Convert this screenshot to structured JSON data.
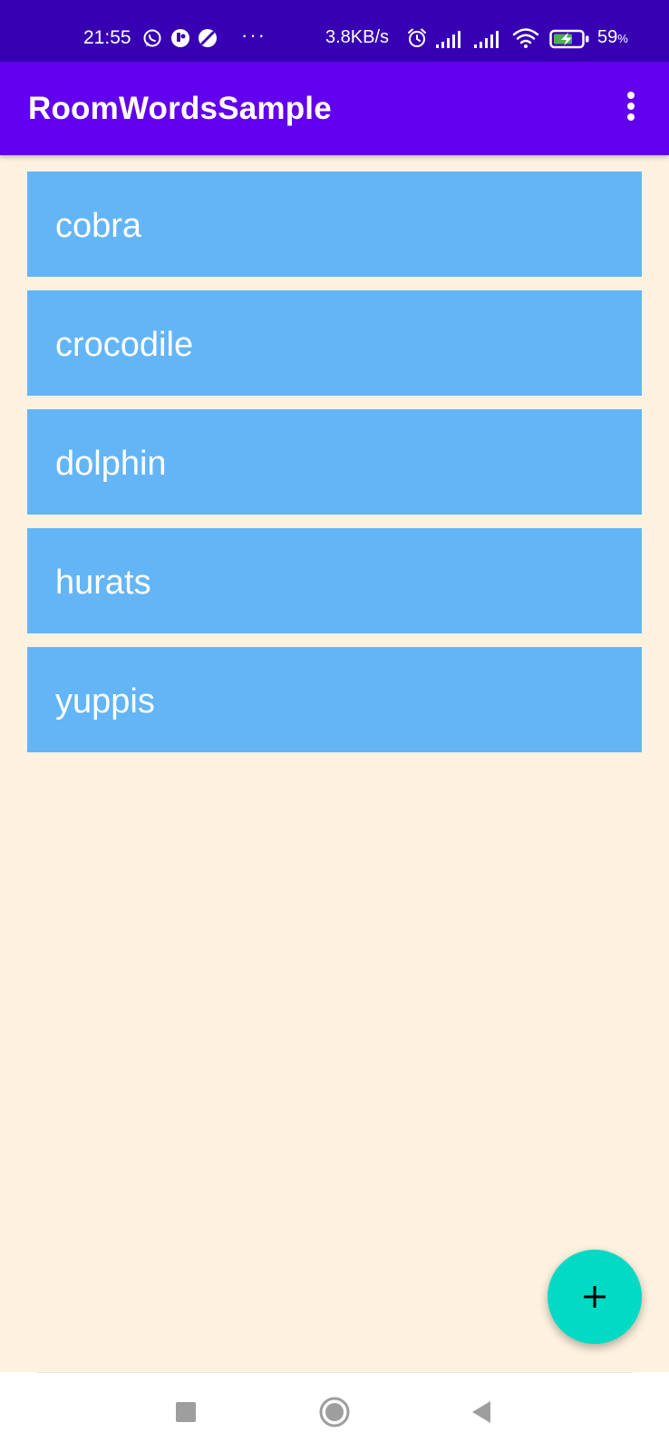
{
  "status_bar": {
    "time": "21:55",
    "network_speed": "3.8KB/s",
    "battery_percent": "59",
    "battery_unit": "%",
    "overflow_dots": "···",
    "icons": [
      "whatsapp-icon",
      "notification-app-icon",
      "browser-icon",
      "alarm-icon",
      "signal-icon",
      "signal-icon",
      "wifi-icon",
      "battery-charging-icon"
    ]
  },
  "app_bar": {
    "title": "RoomWordsSample",
    "overflow_icon": "more-vert-icon"
  },
  "words": [
    {
      "word": "cobra"
    },
    {
      "word": "crocodile"
    },
    {
      "word": "dolphin"
    },
    {
      "word": "hurats"
    },
    {
      "word": "yuppis"
    }
  ],
  "fab": {
    "icon": "plus-icon"
  },
  "nav_bar": {
    "icons": [
      "recents-square-icon",
      "home-circle-icon",
      "back-triangle-icon"
    ]
  },
  "colors": {
    "status_bar": "#3700b3",
    "app_bar": "#6200ee",
    "background": "#fdf1df",
    "item_background": "#64b5f6",
    "item_text": "#ffffff",
    "fab": "#03dac5"
  }
}
